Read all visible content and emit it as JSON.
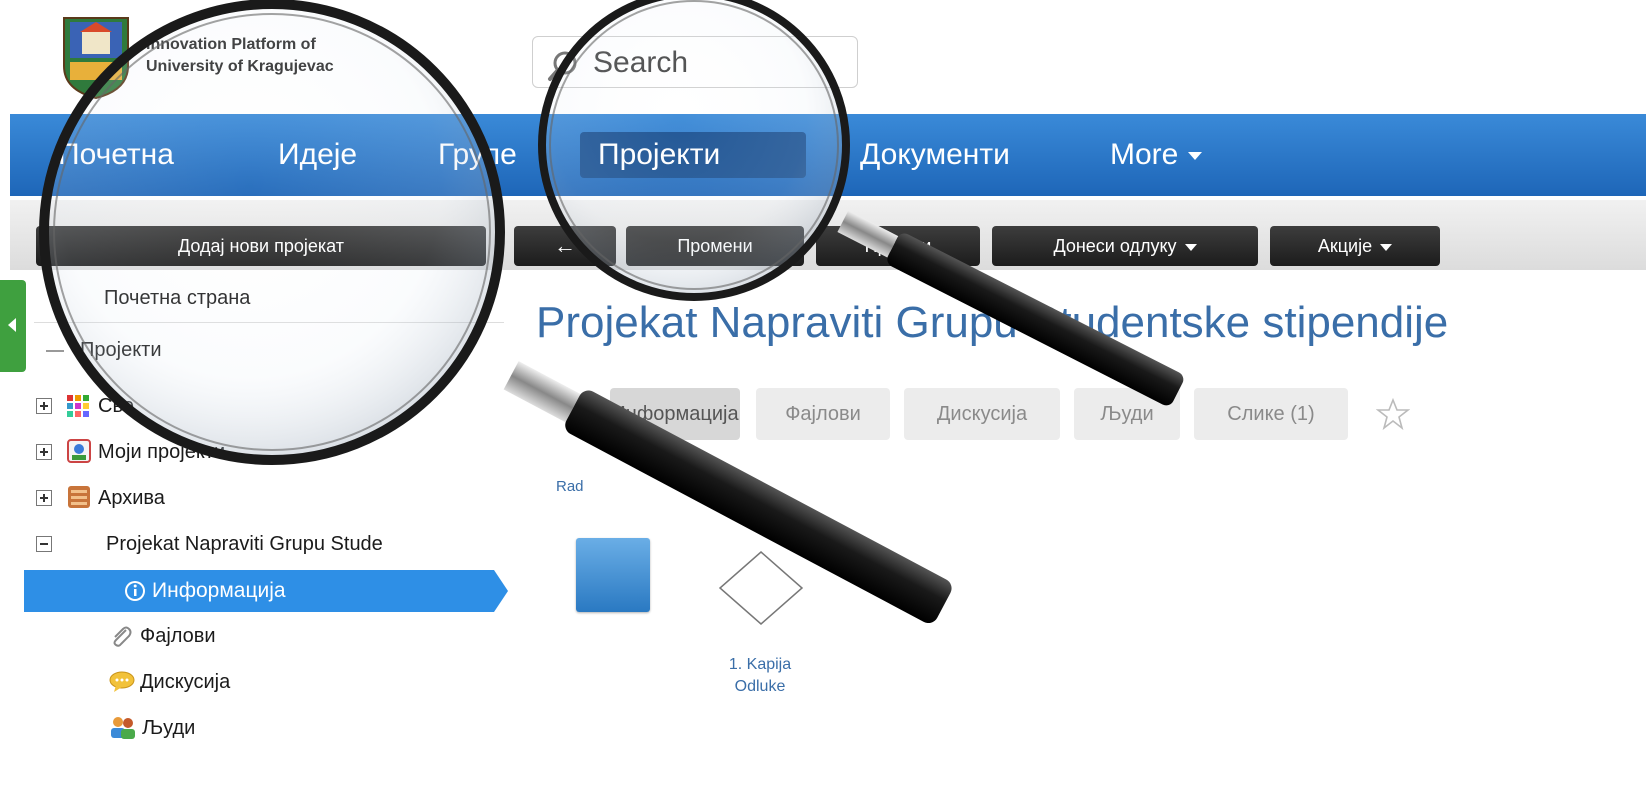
{
  "header": {
    "brand_line1": "Innovation Platform of",
    "brand_line2": "University of Kragujevac",
    "search_placeholder": "Search"
  },
  "nav": {
    "items": [
      {
        "label": "Почетна"
      },
      {
        "label": "Идеје"
      },
      {
        "label": "Групе"
      },
      {
        "label": "Пројекти"
      },
      {
        "label": "Документи"
      },
      {
        "label": "More"
      }
    ],
    "active": "Пројекти"
  },
  "toolbar": {
    "add_project": "Додај нови пројекат",
    "back": "←",
    "edit": "Промени",
    "hidden_btn": "Пријави",
    "decide": "Донеси одлуку",
    "actions": "Акције"
  },
  "sidebar": {
    "home": "Почетна страна",
    "projects": "Пројекти",
    "all": "Све",
    "my_projects": "Моји пројекти",
    "archive": "Архива",
    "project_name": "Projekat Napraviti Grupu Stude",
    "info": "Информација",
    "files": "Фајлови",
    "discussion": "Дискусија",
    "people": "Људи"
  },
  "main": {
    "title": "Projekat Napraviti Grupu Studentske stipendije",
    "tabs": [
      "Информација",
      "Фајлови",
      "Дискусија",
      "Људи",
      "Слике (1)"
    ],
    "star_icon": "star-outline-icon",
    "rad_link": "Rad",
    "gate_label_line1": "1. Kapija",
    "gate_label_line2": "Odluke"
  },
  "colors": {
    "nav_blue": "#2a7acb",
    "active_nav": "#174f91",
    "sidebar_selected": "#2e8fe6",
    "title_blue": "#3a6ea8"
  }
}
